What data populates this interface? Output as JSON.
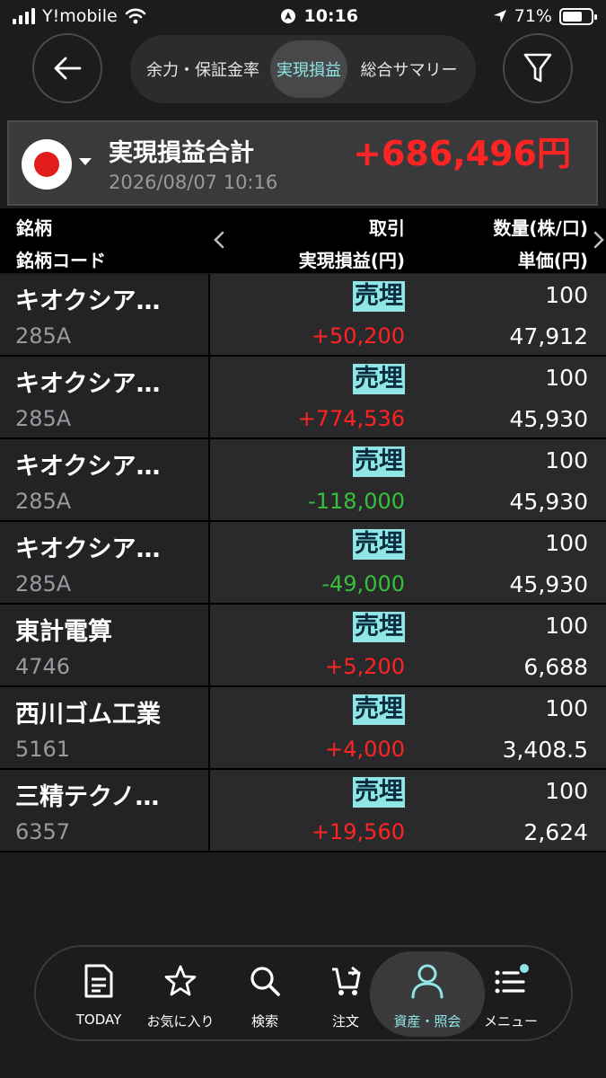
{
  "status_bar": {
    "carrier": "Y!mobile",
    "time": "10:16",
    "battery": "71%",
    "battery_level": 0.71
  },
  "header": {
    "tabs": [
      {
        "label": "余力・保証金率",
        "active": false
      },
      {
        "label": "実現損益",
        "active": true
      },
      {
        "label": "総合サマリー",
        "active": false
      }
    ]
  },
  "summary": {
    "title": "実現損益合計",
    "date": "2026/08/07 10:16",
    "total": "+686,496円"
  },
  "columns": {
    "c1_top": "銘柄",
    "c1_bottom": "銘柄コード",
    "c2_top": "取引",
    "c2_bottom": "実現損益(円)",
    "c3_top": "数量(株/口)",
    "c3_bottom": "単価(円)"
  },
  "rows": [
    {
      "name": "キオクシア…",
      "code": "285A",
      "trade": "売埋",
      "pl": "+50,200",
      "pl_sign": "pos",
      "qty": "100",
      "price": "47,912"
    },
    {
      "name": "キオクシア…",
      "code": "285A",
      "trade": "売埋",
      "pl": "+774,536",
      "pl_sign": "pos",
      "qty": "100",
      "price": "45,930"
    },
    {
      "name": "キオクシア…",
      "code": "285A",
      "trade": "売埋",
      "pl": "-118,000",
      "pl_sign": "neg",
      "qty": "100",
      "price": "45,930"
    },
    {
      "name": "キオクシア…",
      "code": "285A",
      "trade": "売埋",
      "pl": "-49,000",
      "pl_sign": "neg",
      "qty": "100",
      "price": "45,930"
    },
    {
      "name": "東計電算",
      "code": "4746",
      "trade": "売埋",
      "pl": "+5,200",
      "pl_sign": "pos",
      "qty": "100",
      "price": "6,688"
    },
    {
      "name": "西川ゴム工業",
      "code": "5161",
      "trade": "売埋",
      "pl": "+4,000",
      "pl_sign": "pos",
      "qty": "100",
      "price": "3,408.5"
    },
    {
      "name": "三精テクノ…",
      "code": "6357",
      "trade": "売埋",
      "pl": "+19,560",
      "pl_sign": "pos",
      "qty": "100",
      "price": "2,624"
    }
  ],
  "bottom_nav": {
    "items": [
      {
        "label": "TODAY",
        "icon": "document-icon"
      },
      {
        "label": "お気に入り",
        "icon": "star-icon"
      },
      {
        "label": "検索",
        "icon": "search-icon"
      },
      {
        "label": "注文",
        "icon": "cart-icon"
      },
      {
        "label": "資産・照会",
        "icon": "person-icon",
        "active": true
      },
      {
        "label": "メニュー",
        "icon": "menu-icon"
      }
    ]
  },
  "colors": {
    "accent": "#8fe6e4",
    "positive": "#ff2424",
    "negative": "#36c03a",
    "flag_red": "#e21b1b"
  }
}
